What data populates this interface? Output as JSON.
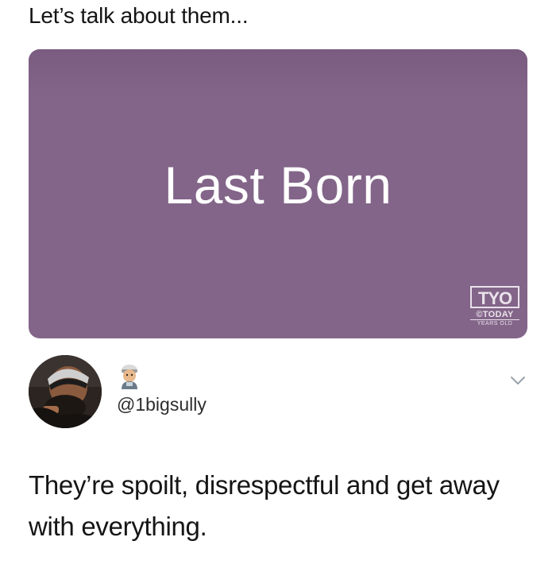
{
  "header": {
    "caption": "Let’s talk about them..."
  },
  "card": {
    "title": "Last Born",
    "background": "#836589",
    "watermark": {
      "logo": "TYO",
      "line1": "©TODAY",
      "line2": "YEARS OLD"
    }
  },
  "tweet": {
    "avatar_icon": "profile-photo",
    "emoji_icon": "person-emoji-icon",
    "handle": "@1bigsully",
    "menu_icon": "chevron-down-icon",
    "text": "They’re spoilt, disrespectful and get away with everything."
  }
}
